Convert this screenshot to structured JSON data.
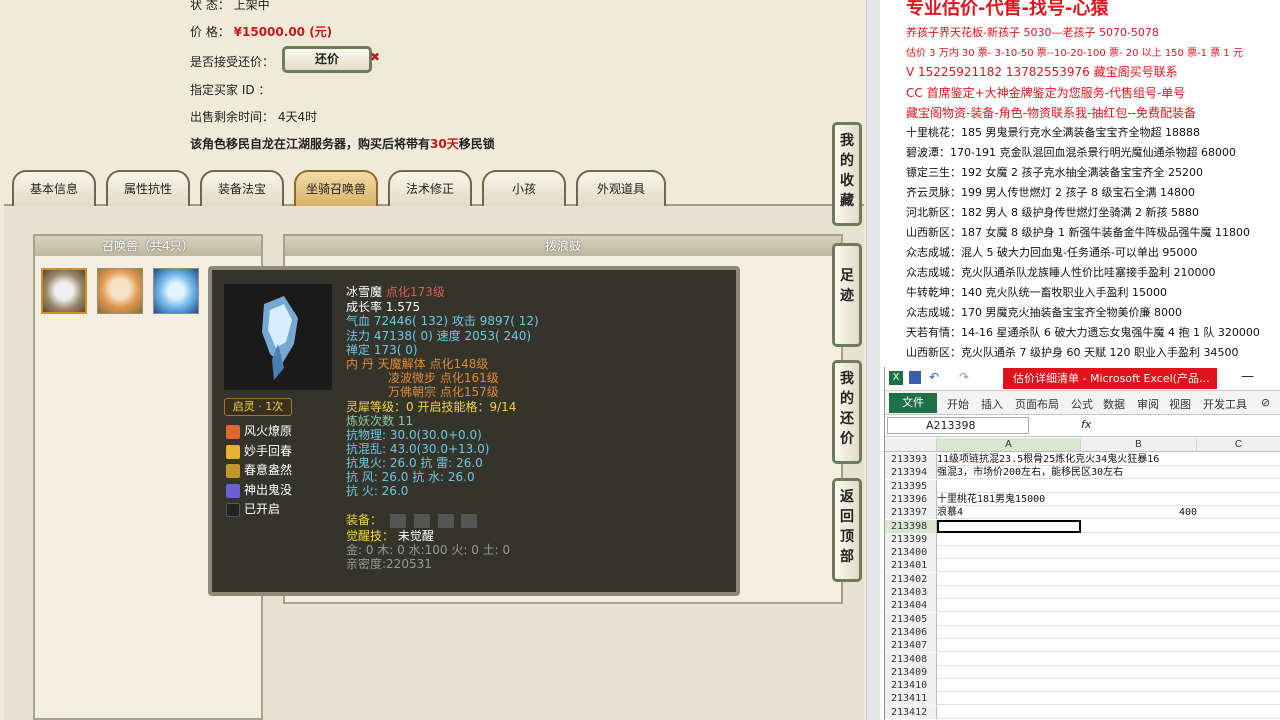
{
  "game": {
    "status_label": "状      态：",
    "status_value": "上架中",
    "price_label": "价      格：",
    "price_value": "¥15000.00 (元)",
    "haggle_label": "是否接受还价：",
    "haggle_button": "还价",
    "buyer_label": "指定买家 ID ：",
    "remain_label": "出售剩余时间：",
    "remain_value": "4天4时",
    "migrate_notice_pre": "该角色移民自龙在江湖服务器，购买后将带有",
    "migrate_notice_red": "30天",
    "migrate_notice_post": "移民锁",
    "tabs": [
      "基本信息",
      "属性抗性",
      "装备法宝",
      "坐骑召唤兽",
      "法术修正",
      "小孩",
      "外观道具"
    ],
    "summon_header": "召唤兽（共4只）",
    "detail_header": "拨浪鼓",
    "side_buttons": [
      "我的收藏",
      "足迹",
      "我的还价",
      "返回顶部"
    ]
  },
  "tooltip": {
    "name": "冰雪魔",
    "name_suffix": "点化173级",
    "growth": "成长率 1.575",
    "hp": "气血 72446( 132)",
    "atk": "攻击 9897( 12)",
    "mp": "法力 47138( 0)",
    "spd": "速度 2053( 240)",
    "fix": "禅定 173( 0)",
    "inner1": "内    丹  天魔解体  点化148级",
    "inner2": "凌波微步  点化161级",
    "inner3": "万佛朝宗  点化157级",
    "rank": "灵犀等级：0 开启技能格：9/14",
    "refine": "炼妖次数 11",
    "res1": "抗物理: 30.0(30.0+0.0)",
    "res2": "抗混乱: 43.0(30.0+13.0)",
    "res3": "抗鬼火: 26.0  抗    雷: 26.0",
    "res4": "抗    风: 26.0  抗    水: 26.0",
    "res5": "抗    火: 26.0",
    "equip": "装备：",
    "awaken_label": "觉醒技：",
    "awaken_value": "未觉醒",
    "elements": "金: 0  木: 0  水:100  火: 0  土: 0",
    "intimacy": "亲密度:220531",
    "badge": "启灵 · 1次",
    "skills": [
      "风火燎原",
      "妙手回春",
      "春意盎然",
      "神出鬼没",
      "已开启"
    ],
    "skill_colors": [
      "#e0672b",
      "#e8b331",
      "#c2962c",
      "#6b5fd8",
      "#222222"
    ]
  },
  "ad": {
    "title": "专业估价-代售-找号-心猿",
    "red_lines": [
      "养孩子界天花板-新孩子 5030—老孩子 5070-5078",
      "估价 3 万内 30 票- 3-10-50 票--10-20-100 票- 20 以上 150 票-1 票 1 元",
      "V 15225921182     13782553976    藏宝阁买号联系",
      "CC 首席鉴定+大神金牌鉴定为您服务-代售组号-单号",
      "藏宝阁物资-装备-角色-物资联系我-抽红包--免费配装备"
    ],
    "black_lines": [
      "十里桃花：185 男鬼景行克水全满装备宝宝齐全物超 18888",
      "碧波潭：170-191 克金队混回血混杀景行明光魔仙通杀物超 68000",
      "镖定三生：192 女魔 2 孩子克水抽全满装备宝宝齐全 25200",
      "齐云灵脉：199 男人传世燃灯 2 孩子 8 级宝石全满 14800",
      "河北新区：182 男人 8 级护身传世燃灯坐骑满 2 新孩 5880",
      "山西新区：187 女魔 8 级护身 1 新强牛装备金牛阵极品强牛魔 11800",
      "众志成城：混人 5 破大力回血鬼-任务通杀-可以单出 95000",
      "众志成城：克火队通杀队龙族睡人性价比哇塞接手盈利 210000",
      "牛转乾坤：140 克火队统一畜牧职业入手盈利 15000",
      "众志成城：170 男魔克火抽装备宝宝齐全物美价廉 8000",
      "天若有情：14-16 星通杀队 6 破大力遗忘女鬼强牛魔 4 抱 1 队 320000",
      "山西新区：克火队通杀 7 级护身 60 天赋 120 职业入手盈利 34500"
    ]
  },
  "excel": {
    "title": "估价详细清单 - Microsoft Excel(产品...",
    "file_tab": "文件",
    "menus": [
      "开始",
      "插入",
      "页面布局",
      "公式",
      "数据",
      "审阅",
      "视图",
      "开发工具"
    ],
    "namebox": "A213398",
    "fx": "fx",
    "col_headers": [
      "A",
      "B",
      "C"
    ],
    "rows": [
      {
        "n": "213393",
        "a": "11级项链抗混23.5根骨25炼化克火34鬼火狂暴16",
        "b": ""
      },
      {
        "n": "213394",
        "a": "强混3，市场价200左右，能移民区30左右",
        "b": ""
      },
      {
        "n": "213395",
        "a": "",
        "b": ""
      },
      {
        "n": "213396",
        "a": "十里桃花181男鬼15000",
        "b": ""
      },
      {
        "n": "213397",
        "a": "浪慕4",
        "b": "400"
      },
      {
        "n": "213398",
        "a": "",
        "b": ""
      },
      {
        "n": "213399",
        "a": "",
        "b": ""
      },
      {
        "n": "213400",
        "a": "",
        "b": ""
      },
      {
        "n": "213401",
        "a": "",
        "b": ""
      },
      {
        "n": "213402",
        "a": "",
        "b": ""
      },
      {
        "n": "213403",
        "a": "",
        "b": ""
      },
      {
        "n": "213404",
        "a": "",
        "b": ""
      },
      {
        "n": "213405",
        "a": "",
        "b": ""
      },
      {
        "n": "213406",
        "a": "",
        "b": ""
      },
      {
        "n": "213407",
        "a": "",
        "b": ""
      },
      {
        "n": "213408",
        "a": "",
        "b": ""
      },
      {
        "n": "213409",
        "a": "",
        "b": ""
      },
      {
        "n": "213410",
        "a": "",
        "b": ""
      },
      {
        "n": "213411",
        "a": "",
        "b": ""
      },
      {
        "n": "213412",
        "a": "",
        "b": ""
      }
    ]
  }
}
